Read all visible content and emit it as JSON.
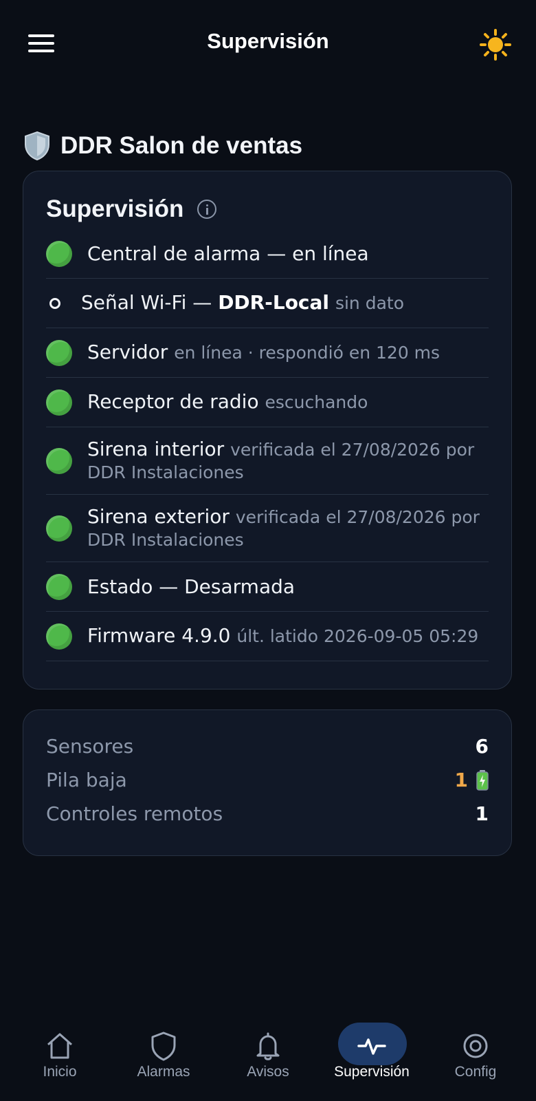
{
  "header": {
    "title": "Supervisión"
  },
  "site": {
    "name": "DDR Salon de ventas"
  },
  "supervision_card": {
    "title": "Supervisión",
    "items": [
      {
        "label": "Central de alarma — en línea",
        "detail": ""
      },
      {
        "label": "Señal Wi-Fi — ",
        "strong": "DDR-Local",
        "detail": "sin dato"
      },
      {
        "label": "Servidor",
        "detail": "en línea · respondió en 120 ms"
      },
      {
        "label": "Receptor de radio",
        "detail": "escuchando"
      },
      {
        "label": "Sirena interior",
        "detail": "verificada el 27/08/2026 por DDR Instalaciones"
      },
      {
        "label": "Sirena exterior",
        "detail": "verificada el 27/08/2026 por DDR Instalaciones"
      },
      {
        "label": "Estado — Desarmada",
        "detail": ""
      },
      {
        "label": "Firmware 4.9.0",
        "detail": "últ. latido 2026-09-05 05:29"
      }
    ]
  },
  "stats": [
    {
      "label": "Sensores",
      "value": "6"
    },
    {
      "label": "Pila baja",
      "value": "1"
    },
    {
      "label": "Controles remotos",
      "value": "1"
    }
  ],
  "nav": [
    {
      "label": "Inicio",
      "icon": "home-icon"
    },
    {
      "label": "Alarmas",
      "icon": "shield-icon"
    },
    {
      "label": "Avisos",
      "icon": "bell-icon"
    },
    {
      "label": "Supervisión",
      "icon": "pulse-icon"
    },
    {
      "label": "Config",
      "icon": "target-icon"
    }
  ],
  "colors": {
    "ok": "#4fb84a",
    "warn": "#f0a84a",
    "active_nav": "#1e3b6a"
  }
}
